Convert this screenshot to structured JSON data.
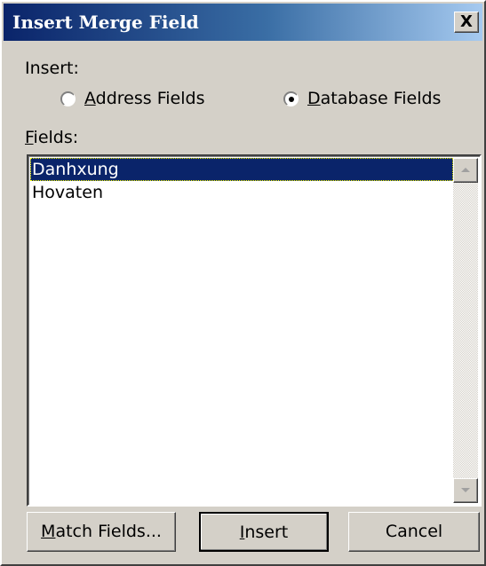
{
  "window": {
    "title": "Insert Merge Field",
    "close_label": "X"
  },
  "insert_group": {
    "label": "Insert:",
    "options": [
      {
        "label": "Address Fields",
        "mnemonic": "A",
        "rest": "ddress Fields",
        "selected": false
      },
      {
        "label": "Database Fields",
        "mnemonic": "D",
        "rest": "atabase Fields",
        "selected": true
      }
    ]
  },
  "fields": {
    "label": "Fields:",
    "mnemonic": "F",
    "rest": "ields:",
    "items": [
      "Danhxung",
      "Hovaten"
    ],
    "selected_index": 0
  },
  "buttons": {
    "match_fields": {
      "label": "Match Fields...",
      "mnemonic": "M",
      "rest": "atch Fields..."
    },
    "insert": {
      "label": "Insert",
      "mnemonic": "I",
      "rest": "nsert"
    },
    "cancel": {
      "label": "Cancel"
    }
  },
  "colors": {
    "face": "#d4d0c8",
    "title_start": "#0a246a",
    "title_end": "#a6caf0",
    "selection": "#0a246a"
  }
}
